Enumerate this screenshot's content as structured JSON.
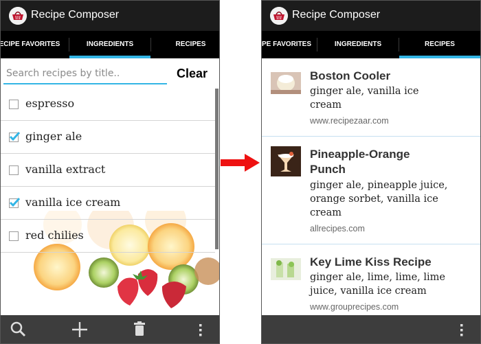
{
  "app": {
    "title": "Recipe Composer",
    "icon": "basket-icon"
  },
  "left_screen": {
    "tabs": [
      {
        "label": "ECIPE FAVORITES",
        "selected": false
      },
      {
        "label": "INGREDIENTS",
        "selected": true
      },
      {
        "label": "RECIPES",
        "selected": false
      }
    ],
    "search": {
      "placeholder": "Search recipes by title..",
      "value": ""
    },
    "clear_label": "Clear",
    "ingredients": [
      {
        "label": "espresso",
        "checked": false
      },
      {
        "label": "ginger ale",
        "checked": true
      },
      {
        "label": "vanilla extract",
        "checked": false
      },
      {
        "label": "vanilla ice cream",
        "checked": true
      },
      {
        "label": "red chilies",
        "checked": false
      }
    ],
    "bottom_actions": [
      "search-icon",
      "add-icon",
      "trash-icon",
      "overflow-menu-icon"
    ]
  },
  "right_screen": {
    "tabs": [
      {
        "label": "PE FAVORITES",
        "selected": false
      },
      {
        "label": "INGREDIENTS",
        "selected": false
      },
      {
        "label": "RECIPES",
        "selected": true
      }
    ],
    "recipes": [
      {
        "title": "Boston Cooler",
        "title_lines": [
          "Boston Cooler"
        ],
        "ingredients_lines": [
          "ginger ale, vanilla ice",
          "cream"
        ],
        "source": "www.recipezaar.com"
      },
      {
        "title": "Pineapple-Orange Punch",
        "title_lines": [
          "Pineapple-Orange",
          "Punch"
        ],
        "ingredients_lines": [
          "ginger ale, pineapple juice,",
          "orange sorbet, vanilla ice",
          "cream"
        ],
        "source": "allrecipes.com"
      },
      {
        "title": "Key Lime Kiss Recipe",
        "title_lines": [
          "Key Lime Kiss Recipe"
        ],
        "ingredients_lines": [
          "ginger ale, lime, lime, lime",
          "juice, vanilla ice cream"
        ],
        "source": "www.grouprecipes.com"
      }
    ],
    "bottom_actions": [
      "overflow-menu-icon"
    ]
  },
  "colors": {
    "accent": "#33b5e5",
    "action_bar": "#1c1c1c",
    "tab_bar": "#000000",
    "bottom_bar": "#3d3d3d",
    "arrow": "#ee1111"
  }
}
